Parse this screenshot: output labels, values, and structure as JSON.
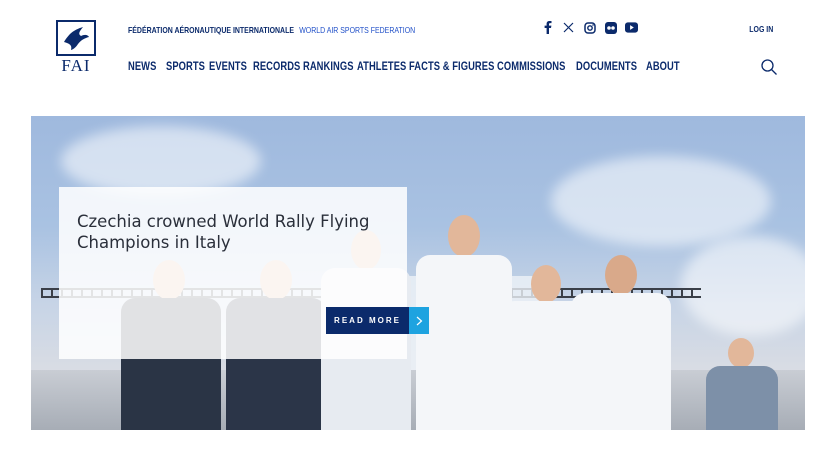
{
  "brand": {
    "logo_text": "FAI",
    "org_name": "FÉDÉRATION AÉRONAUTIQUE INTERNATIONALE",
    "org_subtitle": "WORLD AIR SPORTS FEDERATION",
    "login_label": "LOG IN"
  },
  "social": [
    {
      "icon": "facebook-icon"
    },
    {
      "icon": "x-icon"
    },
    {
      "icon": "instagram-icon"
    },
    {
      "icon": "flickr-icon"
    },
    {
      "icon": "youtube-icon"
    }
  ],
  "nav": {
    "items": [
      {
        "label": "NEWS"
      },
      {
        "label": "SPORTS"
      },
      {
        "label": "EVENTS"
      },
      {
        "label": "RECORDS"
      },
      {
        "label": "RANKINGS"
      },
      {
        "label": "ATHLETES"
      },
      {
        "label": "FACTS & FIGURES"
      },
      {
        "label": "COMMISSIONS"
      },
      {
        "label": "DOCUMENTS"
      },
      {
        "label": "ABOUT"
      }
    ],
    "search_icon": "search-icon"
  },
  "hero": {
    "title": "Czechia crowned World Rally Flying Champions in Italy",
    "cta_label": "READ MORE",
    "cta_icon": "chevron-right-icon"
  },
  "colors": {
    "navy": "#0b2a6b",
    "accent_blue": "#1f4fc8",
    "cta_arrow": "#1ea3e0"
  }
}
